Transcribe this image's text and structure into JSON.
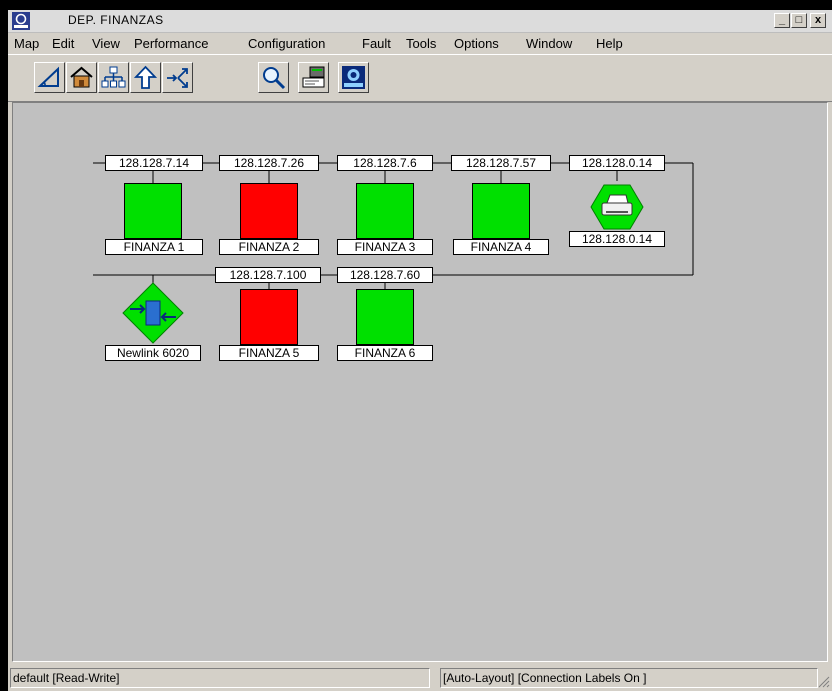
{
  "window": {
    "title": "DEP. FINANZAS",
    "minimize_glyph": "_",
    "maximize_glyph": "□",
    "close_glyph": "x"
  },
  "menu": [
    "Map",
    "Edit",
    "View",
    "Performance",
    "Configuration",
    "Fault",
    "Tools",
    "Options",
    "Window",
    "Help"
  ],
  "toolbar": {
    "icons": [
      "triangle-measure-icon",
      "home-icon",
      "hierarchy-icon",
      "up-arrow-icon",
      "route-arrows-icon",
      "magnifier-icon",
      "device-card-icon",
      "hp-openview-icon"
    ]
  },
  "network": {
    "row1": [
      {
        "ip": "128.128.7.14",
        "name": "FINANZA 1",
        "status": "ok"
      },
      {
        "ip": "128.128.7.26",
        "name": "FINANZA 2",
        "status": "critical"
      },
      {
        "ip": "128.128.7.6",
        "name": "FINANZA 3",
        "status": "ok"
      },
      {
        "ip": "128.128.7.57",
        "name": "FINANZA 4",
        "status": "ok"
      }
    ],
    "printer": {
      "ip": "128.128.0.14",
      "name": "128.128.0.14",
      "status": "ok"
    },
    "switch": {
      "name": "Newlink 6020",
      "status": "ok"
    },
    "row2": [
      {
        "ip": "128.128.7.100",
        "name": "FINANZA 5",
        "status": "critical"
      },
      {
        "ip": "128.128.7.60",
        "name": "FINANZA 6",
        "status": "ok"
      }
    ]
  },
  "colors": {
    "ok": "#00e000",
    "critical": "#ff0000",
    "canvas": "#c0c0c0"
  },
  "status": {
    "left": "default [Read-Write]",
    "right": "[Auto-Layout] [Connection Labels On ]"
  }
}
